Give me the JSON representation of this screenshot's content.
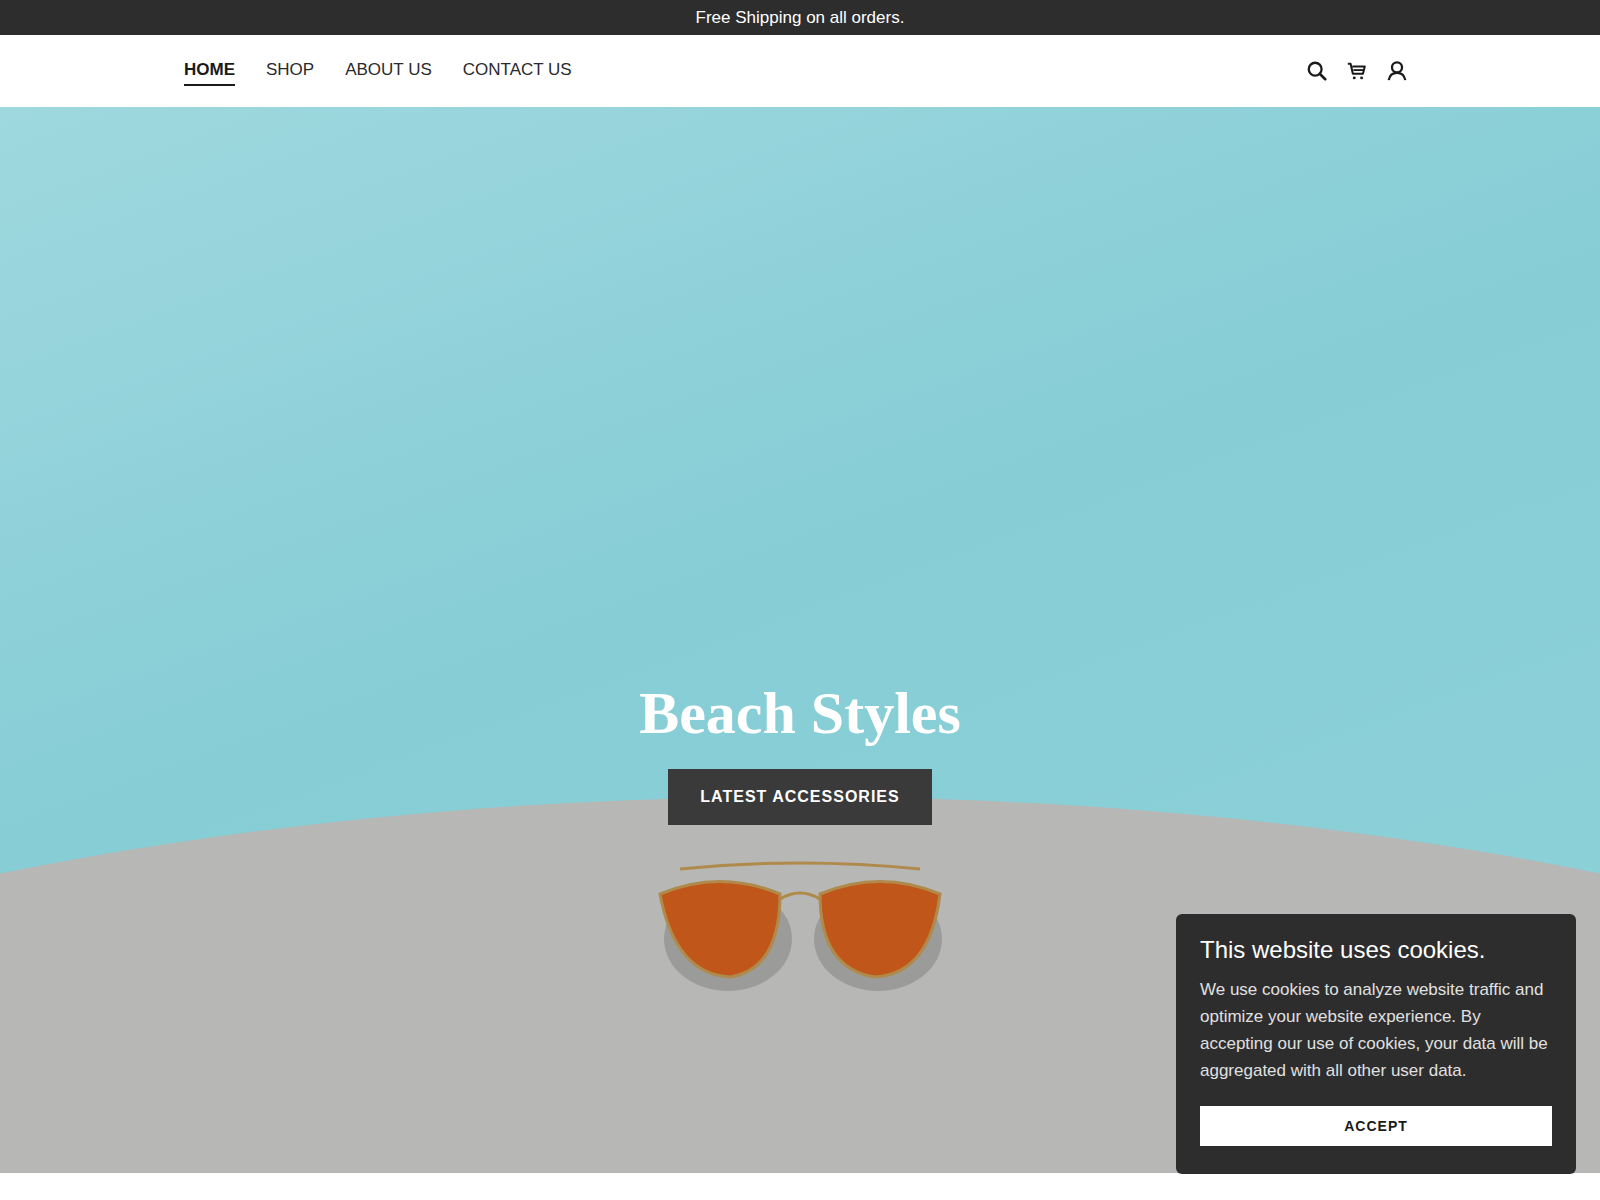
{
  "announcement": "Free Shipping on all orders.",
  "nav": {
    "links": [
      {
        "label": "HOME",
        "selected": true
      },
      {
        "label": "SHOP",
        "selected": false
      },
      {
        "label": "ABOUT US",
        "selected": false
      },
      {
        "label": "CONTACT US",
        "selected": false
      }
    ]
  },
  "hero": {
    "title": "Beach Styles",
    "button": "LATEST ACCESSORIES"
  },
  "cookie_banner": {
    "title": "This website uses cookies.",
    "body": "We use cookies to analyze website traffic and optimize your website experience. By accepting our use of cookies, your data will be aggregated with all other user data.",
    "button": "ACCEPT"
  }
}
